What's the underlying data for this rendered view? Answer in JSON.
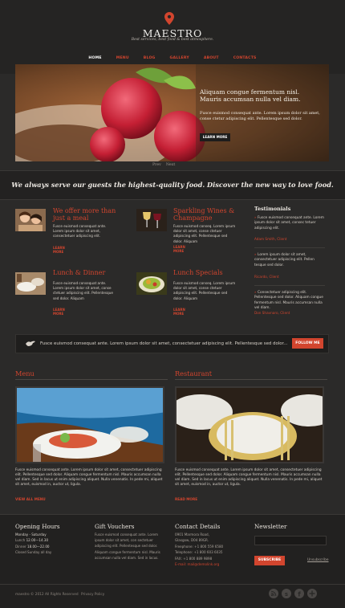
{
  "header": {
    "title": "MAESTRO",
    "tagline": "Best services, best food & best atmosphere.",
    "pin_icon": "map-pin-icon"
  },
  "nav": {
    "items": [
      "HOME",
      "MENU",
      "BLOG",
      "GALLERY",
      "ABOUT",
      "CONTACTS"
    ],
    "active": "HOME"
  },
  "slider": {
    "title": "Aliquam congue fermentum nisl. Mauris accumsan nulla vel diam.",
    "text": "Fusce euismod consequat ante. Lorem ipsum dolor sit amet, conse ctetur adipiscing elit. Pellentesque sed dolor.",
    "button": "LEARN MORE",
    "prev": "Prev",
    "next": "Next"
  },
  "intro": {
    "text": "We always serve our guests the highest-quality food. Discover the new way to love food."
  },
  "features": [
    {
      "title": "We offer more than just a meal",
      "text": "Fusce euismod consequat ante. Lorem ipsum dolor sit amet, consectetuer adipiscing elit.",
      "link": "LEARN MORE"
    },
    {
      "title": "Sparkling Wines & Champagne",
      "text": "Fusce euismod conseq. Lorem ipsum dolor sit amet, conse ctetuer adipiscing elit. Pellentesque sed dolor. Aliquam",
      "link": "LEARN MORE"
    },
    {
      "title": "Lunch & Dinner",
      "text": "Fusce euismod consequat ante. Lorem ipsum dolor sit amet, conse ctetuer adipiscing elit. Pellentesque sed dolor. Aliquam",
      "link": "LEARN MORE"
    },
    {
      "title": "Lunch Specials",
      "text": "Fusce euismod conseq. Lorem ipsum dolor sit amet, conse ctetuer adipiscing elit. Pellentesque sed dolor. Aliquam",
      "link": "LEARN MORE"
    }
  ],
  "testimonials": {
    "title": "Testimonials",
    "items": [
      {
        "text": "Fusce euismod consequat ante. Lorem ipsum dolor sit amet, consec tetuer adipiscing elit.",
        "author": "Adam Smith, Client"
      },
      {
        "text": "Lorem ipsum dolor sit amet, consectetuer adipiscing elit. Pellen tesque sed dolor.",
        "author": "Ricardo, Client"
      },
      {
        "text": "Consectetuer adipiscing elit. Pellentesque sed dolor. Aliquam congue fermentum nisl. Mauris accumsan nulla vel diam.",
        "author": "Don Shavnaro, Client"
      }
    ]
  },
  "band": {
    "text": "Fusce euismod consequat ante. Lorem ipsum dolor sit amet, consectetuer adipiscing elit. Pellentesque sed dolor...",
    "button": "FOLLOW ME"
  },
  "menu_section": {
    "title": "Menu",
    "text": "Fusce euismod consequat ante. Lorem ipsum dolor sit amet, consectetuer adipiscing elit. Pellentesque sed dolor. Aliquam congue fermentum nisl. Mauris accumsan nulla vel diam. Sed in lacus ut enim adipiscing aliquet. Nulla venenatis. In pede mi, aliquet sit amet, euismod in, auctor ut, ligula.",
    "link": "VIEW ALL MENU"
  },
  "restaurant_section": {
    "title": "Restaurant",
    "text": "Fusce euismod consequat ante. Lorem ipsum dolor sit amet, consectetuer adipiscing elit. Pellentesque sed dolor. Aliquam congue fermentum nisl. Mauris accumsan nulla vel diam. Sed in lacus ut enim adipiscing aliquet. Nulla venenatis. In pede mi, aliquet sit amet, euismod in, auctor ut, ligula.",
    "link": "READ MORE"
  },
  "footer": {
    "hours": {
      "title": "Opening Hours",
      "line1": "Monday - Saturday",
      "lunch_label": "Lunch",
      "lunch_time": "12.00—14.30",
      "dinner_label": "Dinner",
      "dinner_time": "18.00—22.00",
      "closed": "Closed Sunday all day"
    },
    "vouchers": {
      "title": "Gift Vouchers",
      "text": "Fusce euismod consequat ante. Lorem ipsum dolor sit amet, con sectetuer adipiscing elit. Pellentesque sed dolor. Aliquam congue fermentum nisl. Mauris accumsan nulla vel diam. Sed in lacus."
    },
    "contact": {
      "title": "Contact Details",
      "address": "0901 Marmora Road,",
      "city": "Glasgow, D04 89GR.",
      "freephone": "Freephone: +1 800 559 6580",
      "telephone": "Telephone: +1 800 603 6035",
      "fax": "FAX: +1 800 889 9898",
      "email": "E-mail: mail@demolink.org"
    },
    "newsletter": {
      "title": "Newsletter",
      "email_placeholder": "",
      "subscribe": "SUBSCRIBE",
      "unsubscribe": "Unsubscribe"
    },
    "copyright": "maestro © 2012 All Rights Reserved",
    "privacy": "Privacy Policy",
    "social": [
      "rss-icon",
      "skype-icon",
      "facebook-icon",
      "google-plus-icon"
    ]
  },
  "colors": {
    "accent": "#d2452e",
    "bg": "#2b2a29",
    "dark": "#222120"
  }
}
